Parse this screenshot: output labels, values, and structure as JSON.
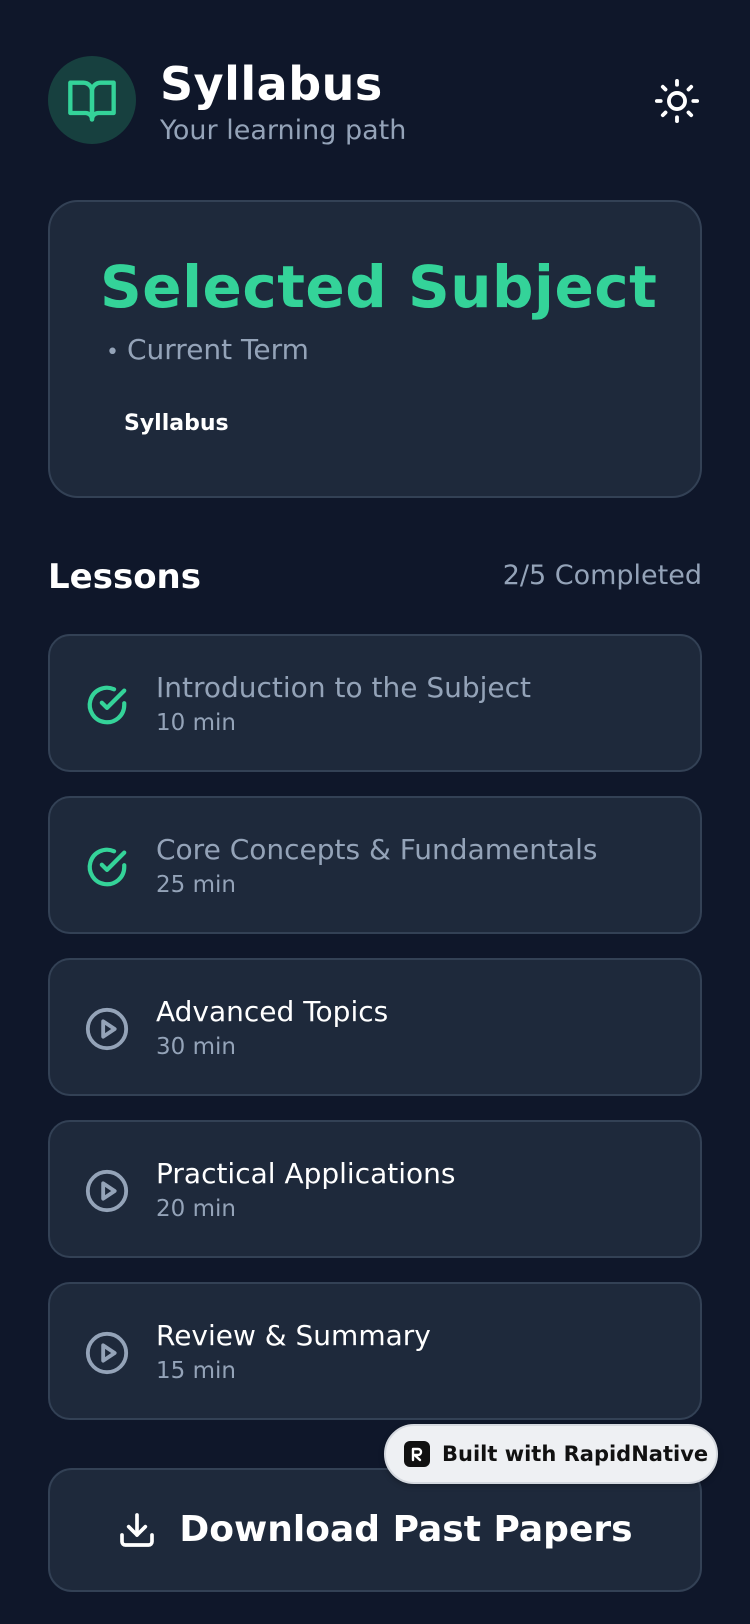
{
  "header": {
    "title": "Syllabus",
    "subtitle": "Your learning path",
    "logo_icon": "book-open-icon",
    "theme_icon": "sun-icon"
  },
  "subject_card": {
    "title": "Selected Subject",
    "meta_bullet": "•",
    "meta_label": "Current Term",
    "tag": "Syllabus"
  },
  "lessons": {
    "heading": "Lessons",
    "progress": "2/5 Completed",
    "completed_count": 2,
    "total_count": 5,
    "items": [
      {
        "title": "Introduction to the Subject",
        "duration": "10 min",
        "status": "completed",
        "icon": "check-circle-icon"
      },
      {
        "title": "Core Concepts & Fundamentals",
        "duration": "25 min",
        "status": "completed",
        "icon": "check-circle-icon"
      },
      {
        "title": "Advanced Topics",
        "duration": "30 min",
        "status": "not-started",
        "icon": "play-circle-icon"
      },
      {
        "title": "Practical Applications",
        "duration": "20 min",
        "status": "not-started",
        "icon": "play-circle-icon"
      },
      {
        "title": "Review & Summary",
        "duration": "15 min",
        "status": "not-started",
        "icon": "play-circle-icon"
      }
    ]
  },
  "download_button": {
    "label": "Download Past Papers",
    "icon": "download-icon"
  },
  "badge": {
    "label": "Built with RapidNative",
    "icon": "rapidnative-logo-icon"
  },
  "colors": {
    "background": "#0f172a",
    "card": "#1e293b",
    "card_border": "#334155",
    "accent": "#34d399",
    "muted_text": "#94a3b8",
    "badge_bg": "#eef0f3"
  }
}
